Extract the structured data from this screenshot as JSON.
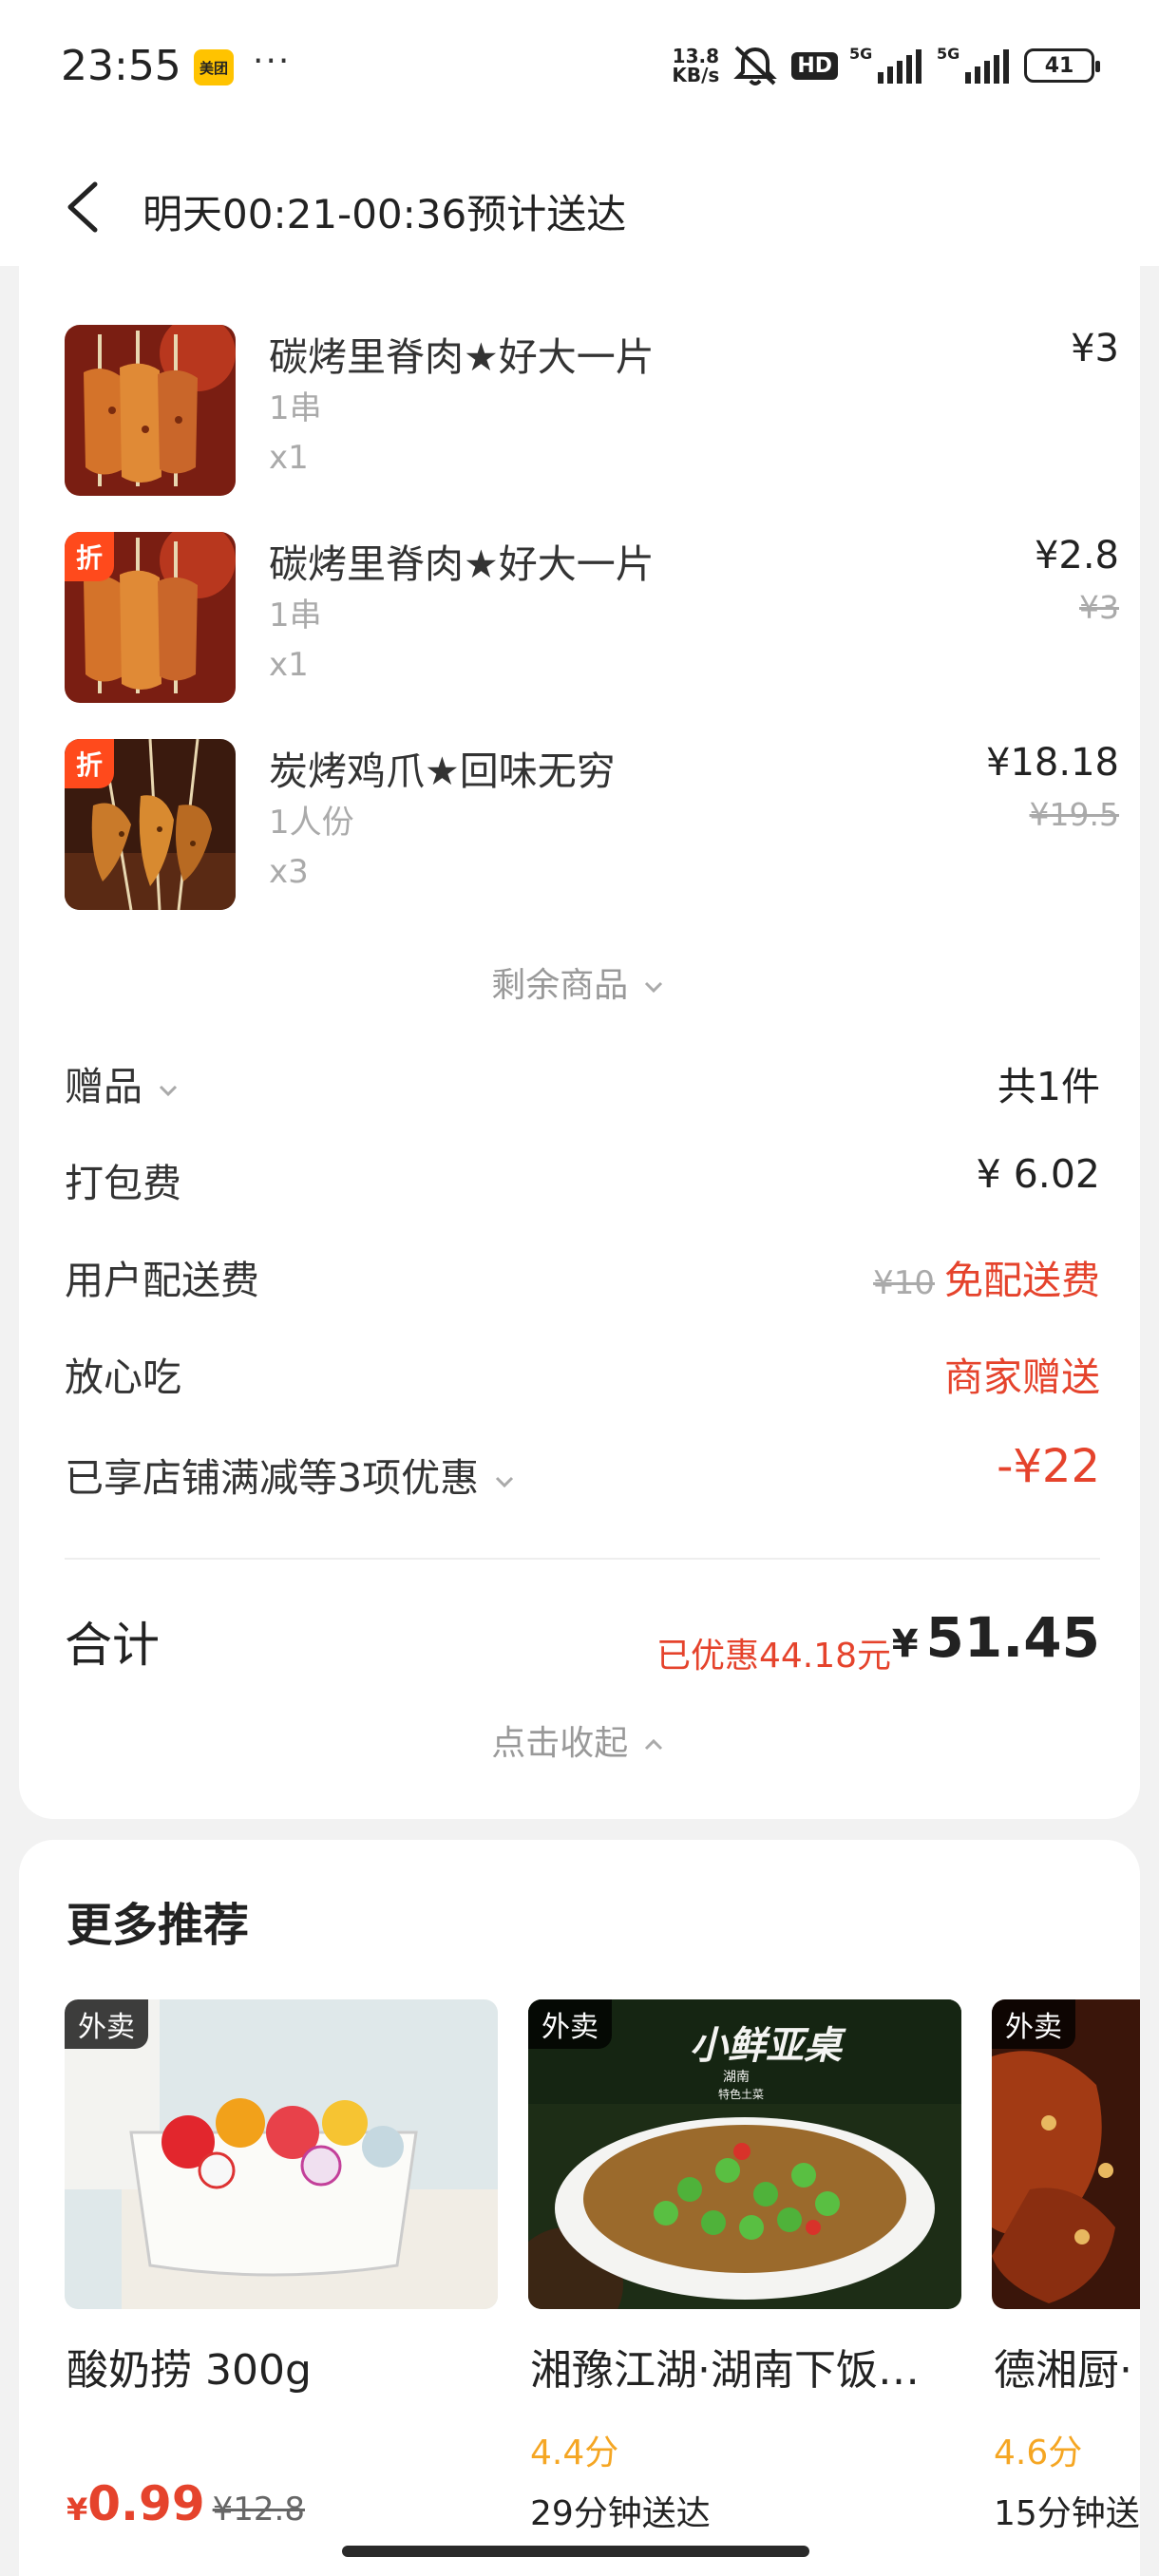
{
  "status_bar": {
    "time": "23:55",
    "app_badge": "美团",
    "more": "···",
    "net_speed_value": "13.8",
    "net_speed_unit": "KB/s",
    "hd": "HD",
    "signal1": "5G",
    "signal2": "5G",
    "battery": "41"
  },
  "header": {
    "title": "明天00:21-00:36预计送达"
  },
  "items": [
    {
      "name": "碳烤里脊肉★好大一片",
      "spec": "1串",
      "qty": "x1",
      "price": "¥3",
      "orig_price": "",
      "discount_tag": ""
    },
    {
      "name": "碳烤里脊肉★好大一片",
      "spec": "1串",
      "qty": "x1",
      "price": "¥2.8",
      "orig_price": "¥3",
      "discount_tag": "折"
    },
    {
      "name": "炭烤鸡爪★回味无穷",
      "spec": "1人份",
      "qty": "x3",
      "price": "¥18.18",
      "orig_price": "¥19.5",
      "discount_tag": "折"
    }
  ],
  "remaining_label": "剩余商品",
  "fees": {
    "gift_label": "赠品",
    "gift_value": "共1件",
    "packing_label": "打包费",
    "packing_value": "¥ 6.02",
    "delivery_label": "用户配送费",
    "delivery_orig": "¥10",
    "delivery_value": "免配送费",
    "safe_label": "放心吃",
    "safe_value": "商家赠送",
    "discount_label": "已享店铺满减等3项优惠",
    "discount_value": "-¥22"
  },
  "total": {
    "label": "合计",
    "saved": "已优惠44.18元",
    "currency": "¥",
    "amount": "51.45",
    "collapse_label": "点击收起"
  },
  "recommend": {
    "title": "更多推荐",
    "tag": "外卖",
    "items": [
      {
        "name": "酸奶捞 300g",
        "price_currency": "¥",
        "price": "0.99",
        "orig_price": "¥12.8",
        "rating": "",
        "delivery": ""
      },
      {
        "name": "湘豫江湖·湖南下饭…",
        "price_currency": "",
        "price": "",
        "orig_price": "",
        "rating": "4.4分",
        "delivery": "29分钟送达",
        "logo_text": "小鲜亚桌",
        "logo_sub1": "湖南",
        "logo_sub2": "特色土菜"
      },
      {
        "name": "德湘厨·",
        "price_currency": "",
        "price": "",
        "orig_price": "",
        "rating": "4.6分",
        "delivery": "15分钟送"
      }
    ]
  },
  "colors": {
    "accent_red": "#e5432c",
    "rating_orange": "#f5a623",
    "discount_tag": "#ff4a1c"
  }
}
